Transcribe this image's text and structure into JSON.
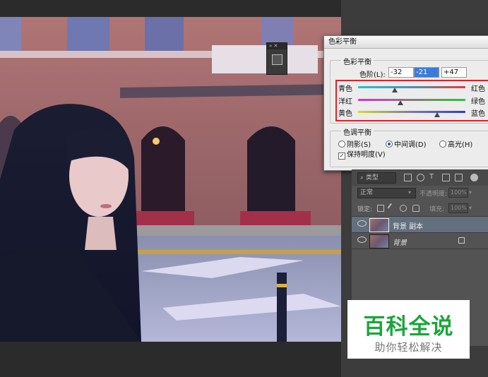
{
  "dialog": {
    "title": "色彩平衡",
    "color_balance": {
      "legend": "色彩平衡",
      "levels_label": "色阶(L):",
      "levels": [
        "-32",
        "-21",
        "+47"
      ],
      "sliders": [
        {
          "left": "青色",
          "right": "红色",
          "value": -32,
          "colors": [
            "#1fc5c9",
            "#e43b3b"
          ]
        },
        {
          "left": "洋红",
          "right": "绿色",
          "value": -21,
          "colors": [
            "#d032d8",
            "#2fc240"
          ]
        },
        {
          "left": "黄色",
          "right": "蓝色",
          "value": 47,
          "colors": [
            "#d8d82a",
            "#2940d6"
          ]
        }
      ],
      "highlight_color": "#e0202a"
    },
    "tone_balance": {
      "legend": "色调平衡",
      "options": [
        "阴影(S)",
        "中间调(D)",
        "高光(H)"
      ],
      "selected": "中间调(D)",
      "preserve_luminosity": "保持明度(V)",
      "preserve_checked": true
    }
  },
  "layers_panel": {
    "filter_label": "类型",
    "blend_mode": "正常",
    "opacity_label": "不透明度:",
    "opacity_value": "100%",
    "lock_label": "锁定:",
    "fill_label": "填充:",
    "fill_value": "100%",
    "layers": [
      {
        "name": "背景 副本",
        "selected": true,
        "locked": false
      },
      {
        "name": "背景",
        "selected": false,
        "locked": true
      }
    ]
  },
  "watermark": {
    "title": "百科全说",
    "subtitle": "助你轻松解决",
    "color": "#1aa63a"
  },
  "mini_panel": {
    "icon": "properties-icon"
  }
}
